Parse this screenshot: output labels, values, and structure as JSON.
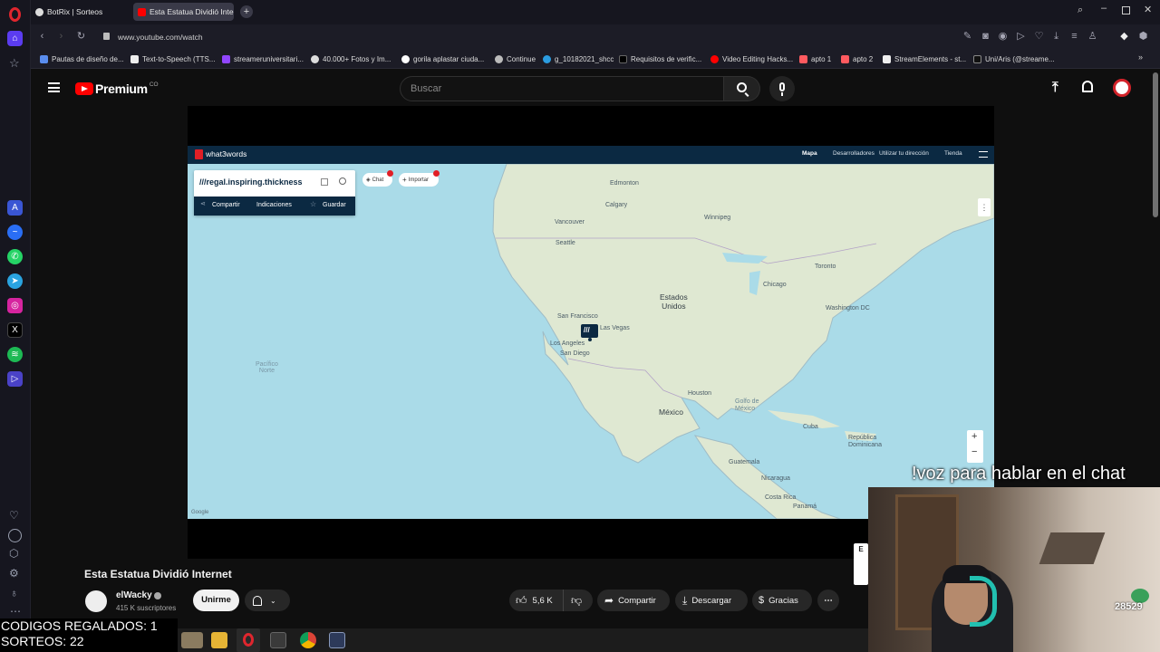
{
  "browser": {
    "tabs": [
      {
        "label": "BotRix | Sorteos",
        "active": false
      },
      {
        "label": "Esta Estatua Dividió Intern",
        "active": true
      }
    ],
    "url": "www.youtube.com/watch",
    "bookmarks": [
      "Pautas de diseño de...",
      "Text-to-Speech (TTS...",
      "streameruniversitari...",
      "40.000+ Fotos y Im...",
      "gorila aplastar ciuda...",
      "Continue",
      "g_10182021_shcc",
      "Requisitos de verific...",
      "Video Editing Hacks...",
      "apto 1",
      "apto 2",
      "StreamElements - st...",
      "Uni/Aris (@streame..."
    ]
  },
  "youtube": {
    "logo_text": "Premium",
    "logo_superscript": "CO",
    "search_placeholder": "Buscar"
  },
  "video_frame": {
    "brand": "what3words",
    "nav": [
      "Mapa",
      "Desarrolladores",
      "Utilizar tu dirección",
      "Tienda"
    ],
    "address": "///regal.inspiring.thickness",
    "chip_chat": "Chat",
    "chip_import": "Importar",
    "actions": [
      "Compartir",
      "Indicaciones",
      "Guardar"
    ],
    "marker_label": "///",
    "zoom_in": "+",
    "zoom_out": "−",
    "attribution": "Google",
    "countries": {
      "us": "Estados\nUnidos",
      "mexico": "México",
      "pacific": "Pacífico\nNorte"
    },
    "cities": [
      "Edmonton",
      "Calgary",
      "Winnipeg",
      "Vancouver",
      "Seattle",
      "San Francisco",
      "Las Vegas",
      "Los Angeles",
      "San Diego",
      "Chicago",
      "Washington DC",
      "Toronto",
      "Houston",
      "Guatemala",
      "Nicaragua",
      "Costa Rica",
      "Panamá",
      "Cuba",
      "República Dominicana",
      "Golfo de México"
    ]
  },
  "video": {
    "title": "Esta Estatua Dividió Internet",
    "channel": "elWacky",
    "subscribers": "415 K suscriptores",
    "join_label": "Unirme",
    "likes": "5,6 K",
    "share_label": "Compartir",
    "download_label": "Descargar",
    "thanks_label": "Gracias"
  },
  "stream_overlay": {
    "codes_line": "CODIGOS REGALADOS: 1",
    "raffles_line": "SORTEOS: 22",
    "chat_command": "!voz para hablar en el chat",
    "viewer_count": "28529"
  },
  "colors": {
    "yt_red": "#ff0000",
    "w3w_red": "#e11f26",
    "w3w_navy": "#0b2942",
    "map_water": "#aadbe8",
    "map_land": "#dfe8d2"
  }
}
